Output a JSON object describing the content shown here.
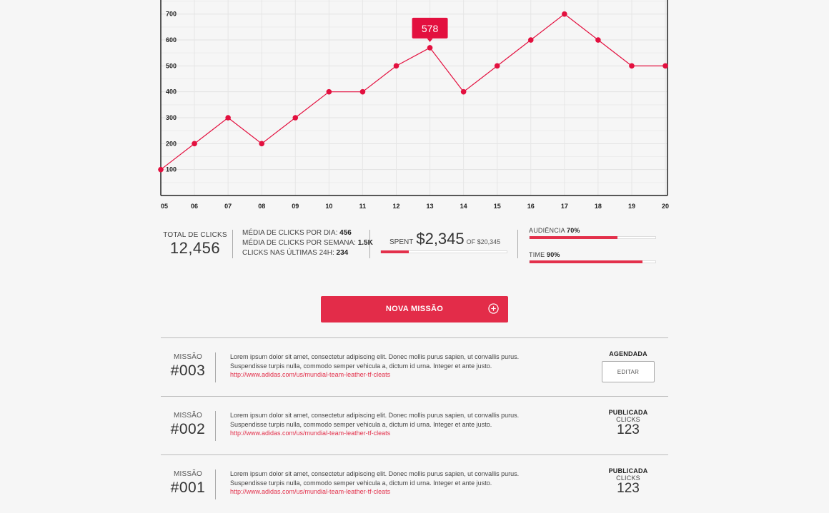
{
  "chart_data": {
    "type": "line",
    "categories": [
      "05",
      "06",
      "07",
      "08",
      "09",
      "10",
      "11",
      "12",
      "13",
      "14",
      "15",
      "16",
      "17",
      "18",
      "19",
      "20"
    ],
    "values": [
      100,
      200,
      300,
      200,
      300,
      400,
      400,
      500,
      570,
      400,
      500,
      600,
      700,
      600,
      500,
      500
    ],
    "y_ticks": [
      100,
      200,
      300,
      400,
      500,
      600,
      700
    ],
    "ylim": [
      0,
      750
    ],
    "grid": true,
    "tooltip": {
      "category": "13",
      "label": "578"
    },
    "color": "#e3103f"
  },
  "stats": {
    "total_label": "TOTAL DE CLICKS",
    "total_value": "12,456",
    "daily_label": "MÉDIA DE CLICKS POR DIA:",
    "daily_value": "456",
    "weekly_label": "MÉDIA DE CLICKS POR SEMANA:",
    "weekly_value": "1.5K",
    "last24_label": "CLICKS NAS ÚLTIMAS 24H:",
    "last24_value": "234",
    "spent_label": "SPENT",
    "spent_value": "$2,345",
    "spent_of": "OF $20,345",
    "spent_fraction": 0.22,
    "audience_label": "AUDIÊNCIA",
    "audience_value": "70%",
    "audience_fraction": 0.7,
    "time_label": "TIME",
    "time_value": "90%",
    "time_fraction": 0.9
  },
  "cta": {
    "label": "NOVA MISSÃO",
    "icon": "plus-circle-icon"
  },
  "missions": [
    {
      "label": "MISSÃO",
      "number": "#003",
      "text": "Lorem ipsum dolor sit amet, consectetur adipiscing elit. Donec mollis purus sapien, ut convallis purus. Suspendisse turpis nulla, commodo semper vehicula a, dictum id urna. Integer et ante justo.",
      "link": "http://www.adidas.com/us/mundial-team-leather-tf-cleats",
      "status": "AGENDADA",
      "action": "EDITAR"
    },
    {
      "label": "MISSÃO",
      "number": "#002",
      "text": "Lorem ipsum dolor sit amet, consectetur adipiscing elit. Donec mollis purus sapien, ut convallis purus. Suspendisse turpis nulla, commodo semper vehicula a, dictum id urna. Integer et ante justo.",
      "link": "http://www.adidas.com/us/mundial-team-leather-tf-cleats",
      "status": "PUBLICADA",
      "clicks_label": "CLICKS",
      "clicks": "123"
    },
    {
      "label": "MISSÃO",
      "number": "#001",
      "text": "Lorem ipsum dolor sit amet, consectetur adipiscing elit. Donec mollis purus sapien, ut convallis purus. Suspendisse turpis nulla, commodo semper vehicula a, dictum id urna. Integer et ante justo.",
      "link": "http://www.adidas.com/us/mundial-team-leather-tf-cleats",
      "status": "PUBLICADA",
      "clicks_label": "CLICKS",
      "clicks": "123"
    }
  ]
}
